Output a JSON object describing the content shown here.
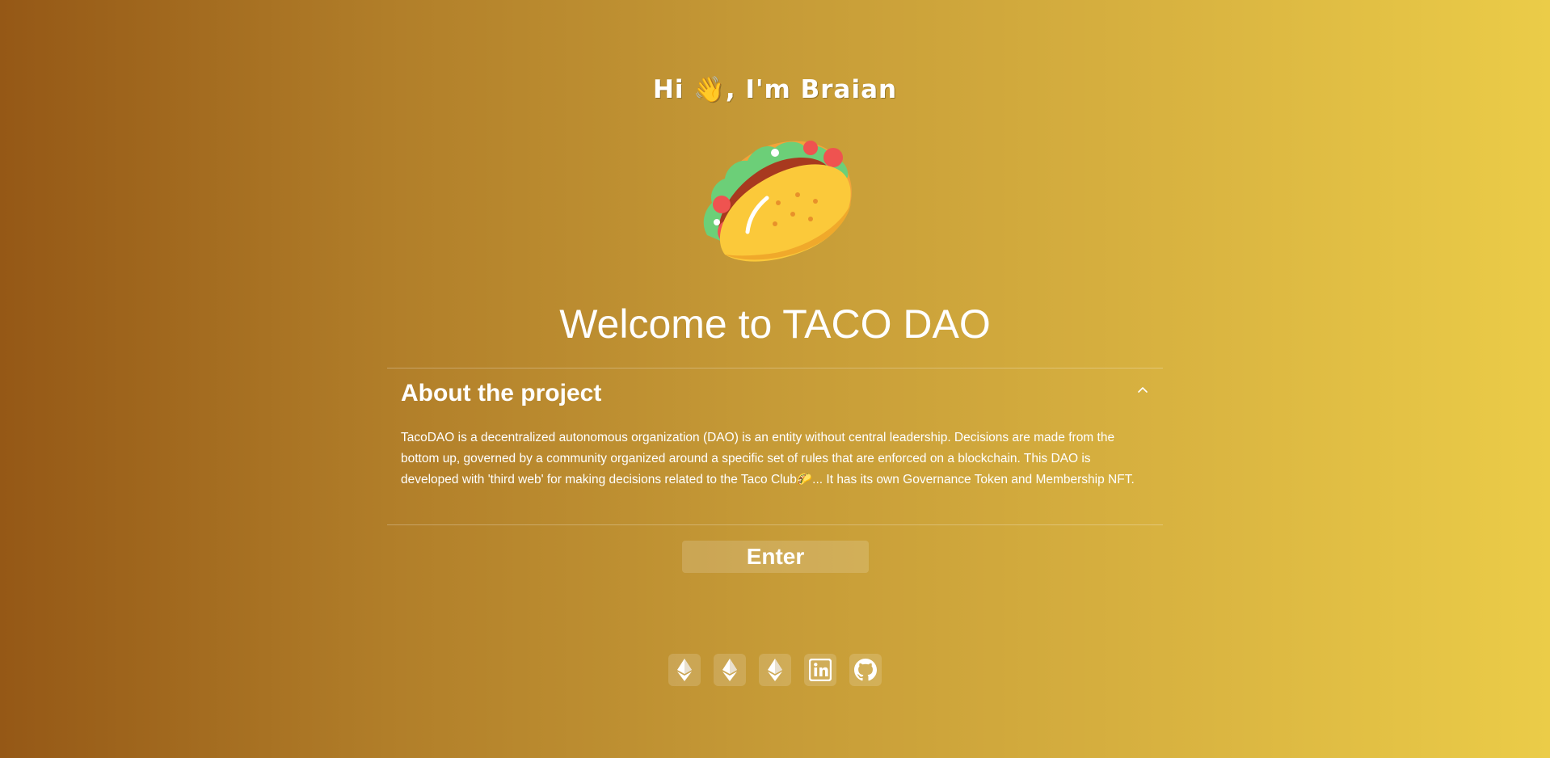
{
  "greeting": {
    "text_before": "Hi ",
    "emoji": "👋",
    "text_after": ", I'm Braian"
  },
  "hero": {
    "image_icon": "taco-icon"
  },
  "welcome_title": "Welcome to TACO DAO",
  "about": {
    "title": "About the project",
    "expanded": true,
    "chevron_icon": "chevron-up-icon",
    "body_before": "TacoDAO is a decentralized autonomous organization (DAO) is an entity without central leadership. Decisions are made from the bottom up, governed by a community organized around a specific set of rules that are enforced on a blockchain. This DAO is developed with 'third web' for making decisions related to the Taco Club",
    "body_emoji": "🌮",
    "body_after": "... It has its own Governance Token and Membership NFT."
  },
  "enter_button": {
    "label": "Enter"
  },
  "social_links": [
    {
      "icon": "ethereum-icon"
    },
    {
      "icon": "ethereum-icon"
    },
    {
      "icon": "ethereum-icon"
    },
    {
      "icon": "linkedin-icon"
    },
    {
      "icon": "github-icon"
    }
  ]
}
